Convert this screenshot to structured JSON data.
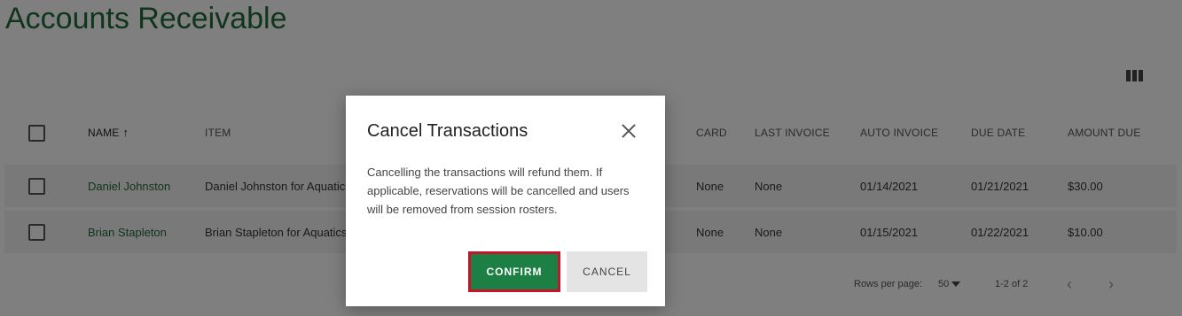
{
  "page": {
    "title": "Accounts Receivable"
  },
  "table": {
    "headers": {
      "name": "NAME",
      "item": "ITEM",
      "card": "CARD",
      "last_invoice": "LAST INVOICE",
      "auto_invoice": "AUTO INVOICE",
      "due_date": "DUE DATE",
      "amount_due": "AMOUNT DUE"
    },
    "sort_icon": "↑",
    "rows": [
      {
        "name": "Daniel Johnston",
        "item": "Daniel Johnston for Aquatic",
        "card": "None",
        "last_invoice": "None",
        "auto_invoice": "01/14/2021",
        "due_date": "01/21/2021",
        "amount_due": "$30.00"
      },
      {
        "name": "Brian Stapleton",
        "item": "Brian Stapleton for Aquatics",
        "card": "None",
        "last_invoice": "None",
        "auto_invoice": "01/15/2021",
        "due_date": "01/22/2021",
        "amount_due": "$10.00"
      }
    ]
  },
  "footer": {
    "rows_per_page_label": "Rows per page:",
    "rows_per_page_value": "50",
    "range": "1-2 of 2",
    "prev_icon": "‹",
    "next_icon": "›"
  },
  "modal": {
    "title": "Cancel Transactions",
    "body": "Cancelling the transactions will refund them. If applicable, reservations will be cancelled and users will be removed from session rosters.",
    "confirm_label": "CONFIRM",
    "cancel_label": "CANCEL"
  },
  "icons": [
    "columns-icon",
    "sort-ascending-icon",
    "close-icon",
    "chevron-left-icon",
    "chevron-right-icon",
    "caret-down-icon"
  ],
  "colors": {
    "brand_green": "#1e6b3a",
    "confirm_bg": "#1c8044",
    "confirm_outline": "#c4132a",
    "overlay": "rgba(0,0,0,0.5)"
  }
}
